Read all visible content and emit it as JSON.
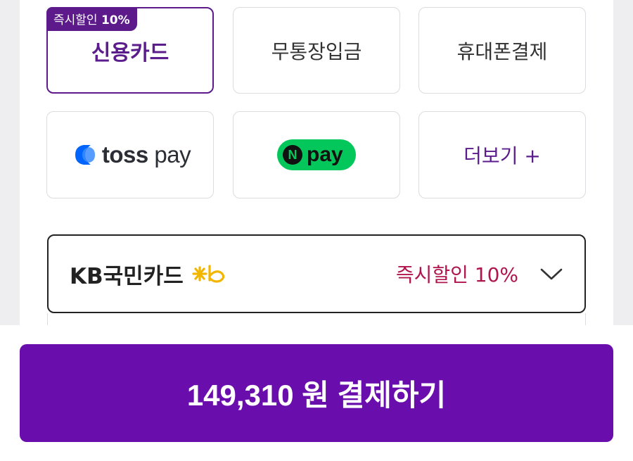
{
  "payment_methods": {
    "credit_card": {
      "label": "신용카드",
      "badge_text": "즉시할인",
      "badge_percent": "10%"
    },
    "bank_transfer": {
      "label": "무통장입금"
    },
    "mobile_payment": {
      "label": "휴대폰결제"
    },
    "toss_pay": {
      "brand": "toss",
      "suffix": "pay"
    },
    "naver_pay": {
      "brand_letter": "N",
      "suffix": "pay"
    },
    "more": {
      "label": "더보기 +"
    }
  },
  "card_selector": {
    "bank_name": "KB국민카드",
    "discount_text": "즉시할인 10%",
    "logo_icon": "kb-logo-icon",
    "dropdown_icon": "chevron-down-icon"
  },
  "checkout": {
    "button_label": "149,310 원 결제하기"
  },
  "colors": {
    "accent": "#5c1a8a",
    "pay_button": "#6a0dad",
    "discount_text": "#b0164e",
    "naver_green": "#03c75a",
    "toss_blue": "#0064ff"
  }
}
